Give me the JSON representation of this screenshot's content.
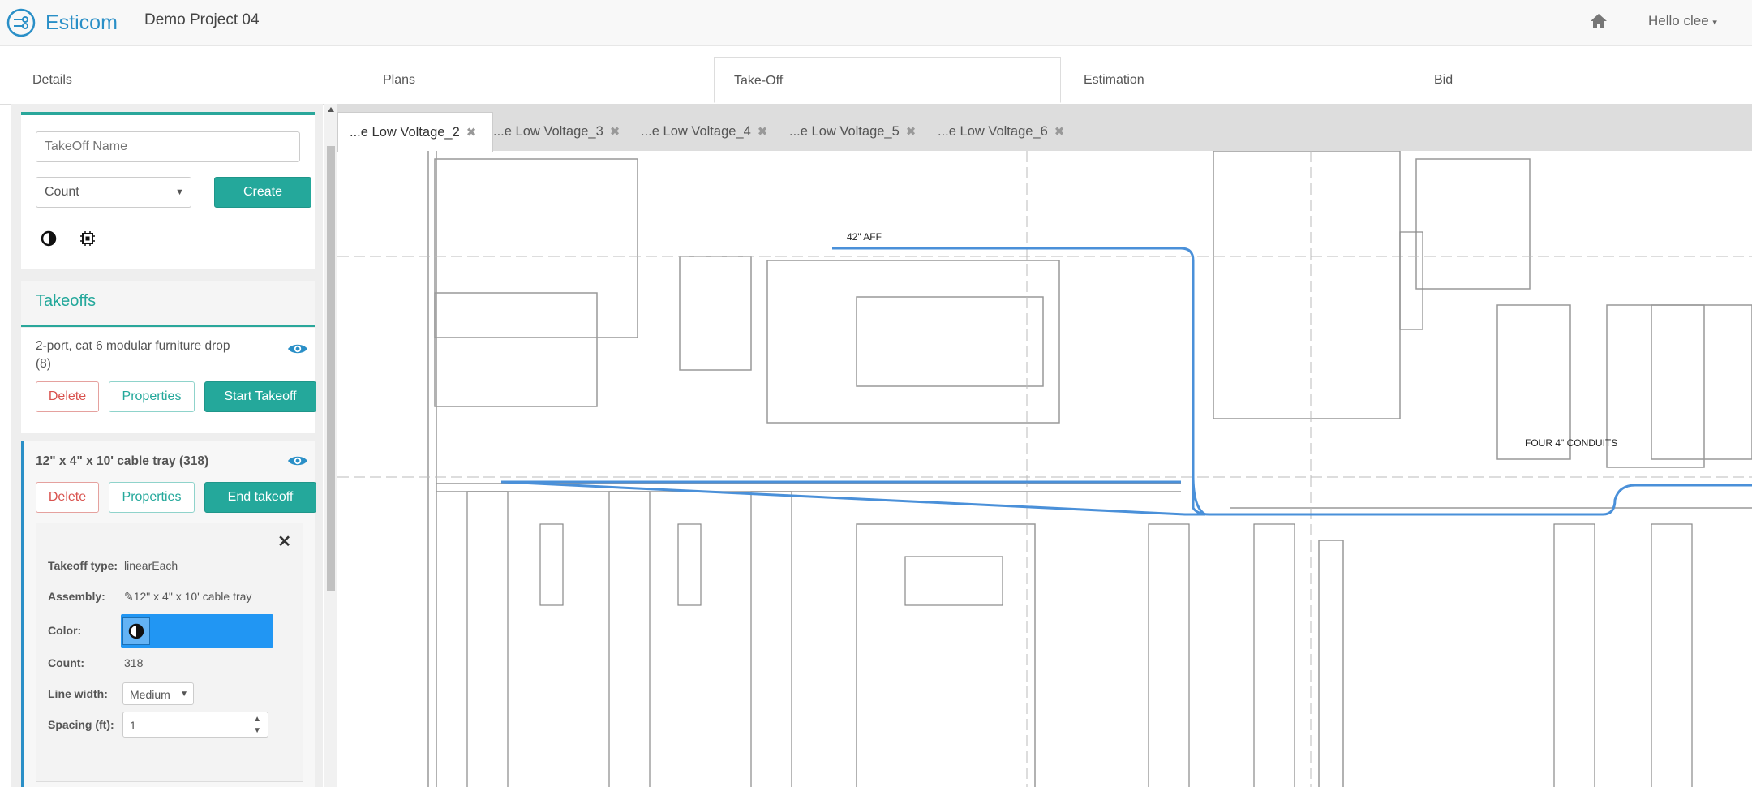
{
  "app": {
    "brand": "Esticom",
    "project": "Demo Project 04",
    "user": "Hello clee"
  },
  "tabs": [
    "Details",
    "Plans",
    "Take-Off",
    "Estimation",
    "Bid"
  ],
  "active_tab": "Take-Off",
  "create_form": {
    "name_placeholder": "TakeOff Name",
    "type_value": "Count",
    "create_label": "Create",
    "icons": [
      "contrast-icon",
      "chip-icon"
    ]
  },
  "takeoffs": {
    "title": "Takeoffs",
    "items": [
      {
        "title_line1": "2-port, cat 6 modular furniture drop",
        "title_line2": "(8)",
        "delete_label": "Delete",
        "properties_label": "Properties",
        "action_label": "Start Takeoff"
      },
      {
        "title": "12\" x 4\" x 10' cable tray (318)",
        "delete_label": "Delete",
        "properties_label": "Properties",
        "action_label": "End takeoff",
        "props": {
          "type_label": "Takeoff type:",
          "type_value": "linearEach",
          "assembly_label": "Assembly:",
          "assembly_value": "12\" x 4\" x 10' cable tray",
          "color_label": "Color:",
          "color_value": "#2196f3",
          "count_label": "Count:",
          "count_value": "318",
          "line_width_label": "Line width:",
          "line_width_value": "Medium",
          "spacing_label": "Spacing (ft):",
          "spacing_value": "1"
        }
      }
    ]
  },
  "doc_tabs": [
    "...e Low Voltage_2",
    "...e Low Voltage_3",
    "...e Low Voltage_4",
    "...e Low Voltage_5",
    "...e Low Voltage_6"
  ],
  "plan_labels": {
    "aff": "42\" AFF",
    "conduits": "FOUR 4\" CONDUITS"
  },
  "colors": {
    "accent": "#24a89b",
    "brand": "#2a8fc7",
    "takeoff_line": "#4a90d9"
  }
}
